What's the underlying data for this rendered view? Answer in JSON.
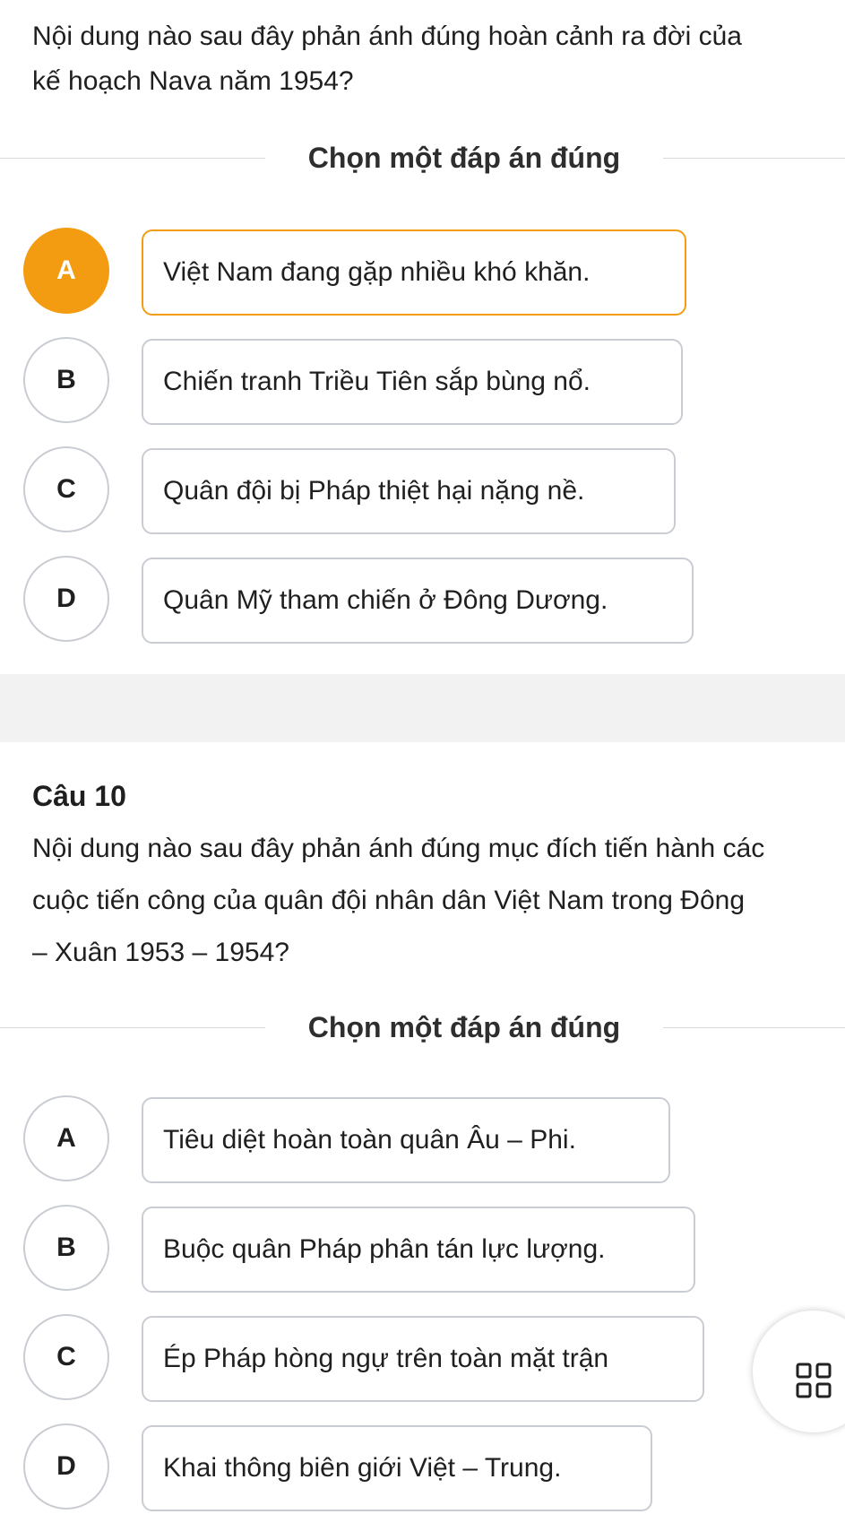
{
  "question1": {
    "text_line1": "Nội dung nào sau đây phản ánh đúng hoàn cảnh ra đời của",
    "text_line2": "kế hoạch Nava năm 1954?",
    "instruction": "Chọn một đáp án đúng",
    "selected": "A",
    "options": [
      {
        "letter": "A",
        "text": "Việt Nam đang gặp nhiều khó khăn."
      },
      {
        "letter": "B",
        "text": "Chiến tranh Triều Tiên sắp bùng nổ."
      },
      {
        "letter": "C",
        "text": "Quân đội bị Pháp thiệt hại nặng nề."
      },
      {
        "letter": "D",
        "text": "Quân Mỹ tham chiến ở Đông Dương."
      }
    ]
  },
  "question2": {
    "number": "Câu 10",
    "text_line1": "Nội dung nào sau đây phản ánh đúng mục đích tiến hành các",
    "text_line2": "cuộc tiến công của quân đội nhân dân Việt Nam trong Đông",
    "text_line3": "– Xuân 1953 – 1954?",
    "instruction": "Chọn một đáp án đúng",
    "options": [
      {
        "letter": "A",
        "text": "Tiêu diệt hoàn toàn quân Âu – Phi."
      },
      {
        "letter": "B",
        "text": "Buộc quân Pháp phân tán lực lượng."
      },
      {
        "letter": "C",
        "text": "Ép Pháp hòng ngự trên toàn mặt trận"
      },
      {
        "letter": "D",
        "text": "Khai thông biên giới Việt – Trung."
      }
    ]
  },
  "floating_button": {
    "icon": "grid-icon"
  },
  "colors": {
    "accent": "#f39c12",
    "border": "#c9cdd3",
    "separator": "#f2f2f2"
  }
}
